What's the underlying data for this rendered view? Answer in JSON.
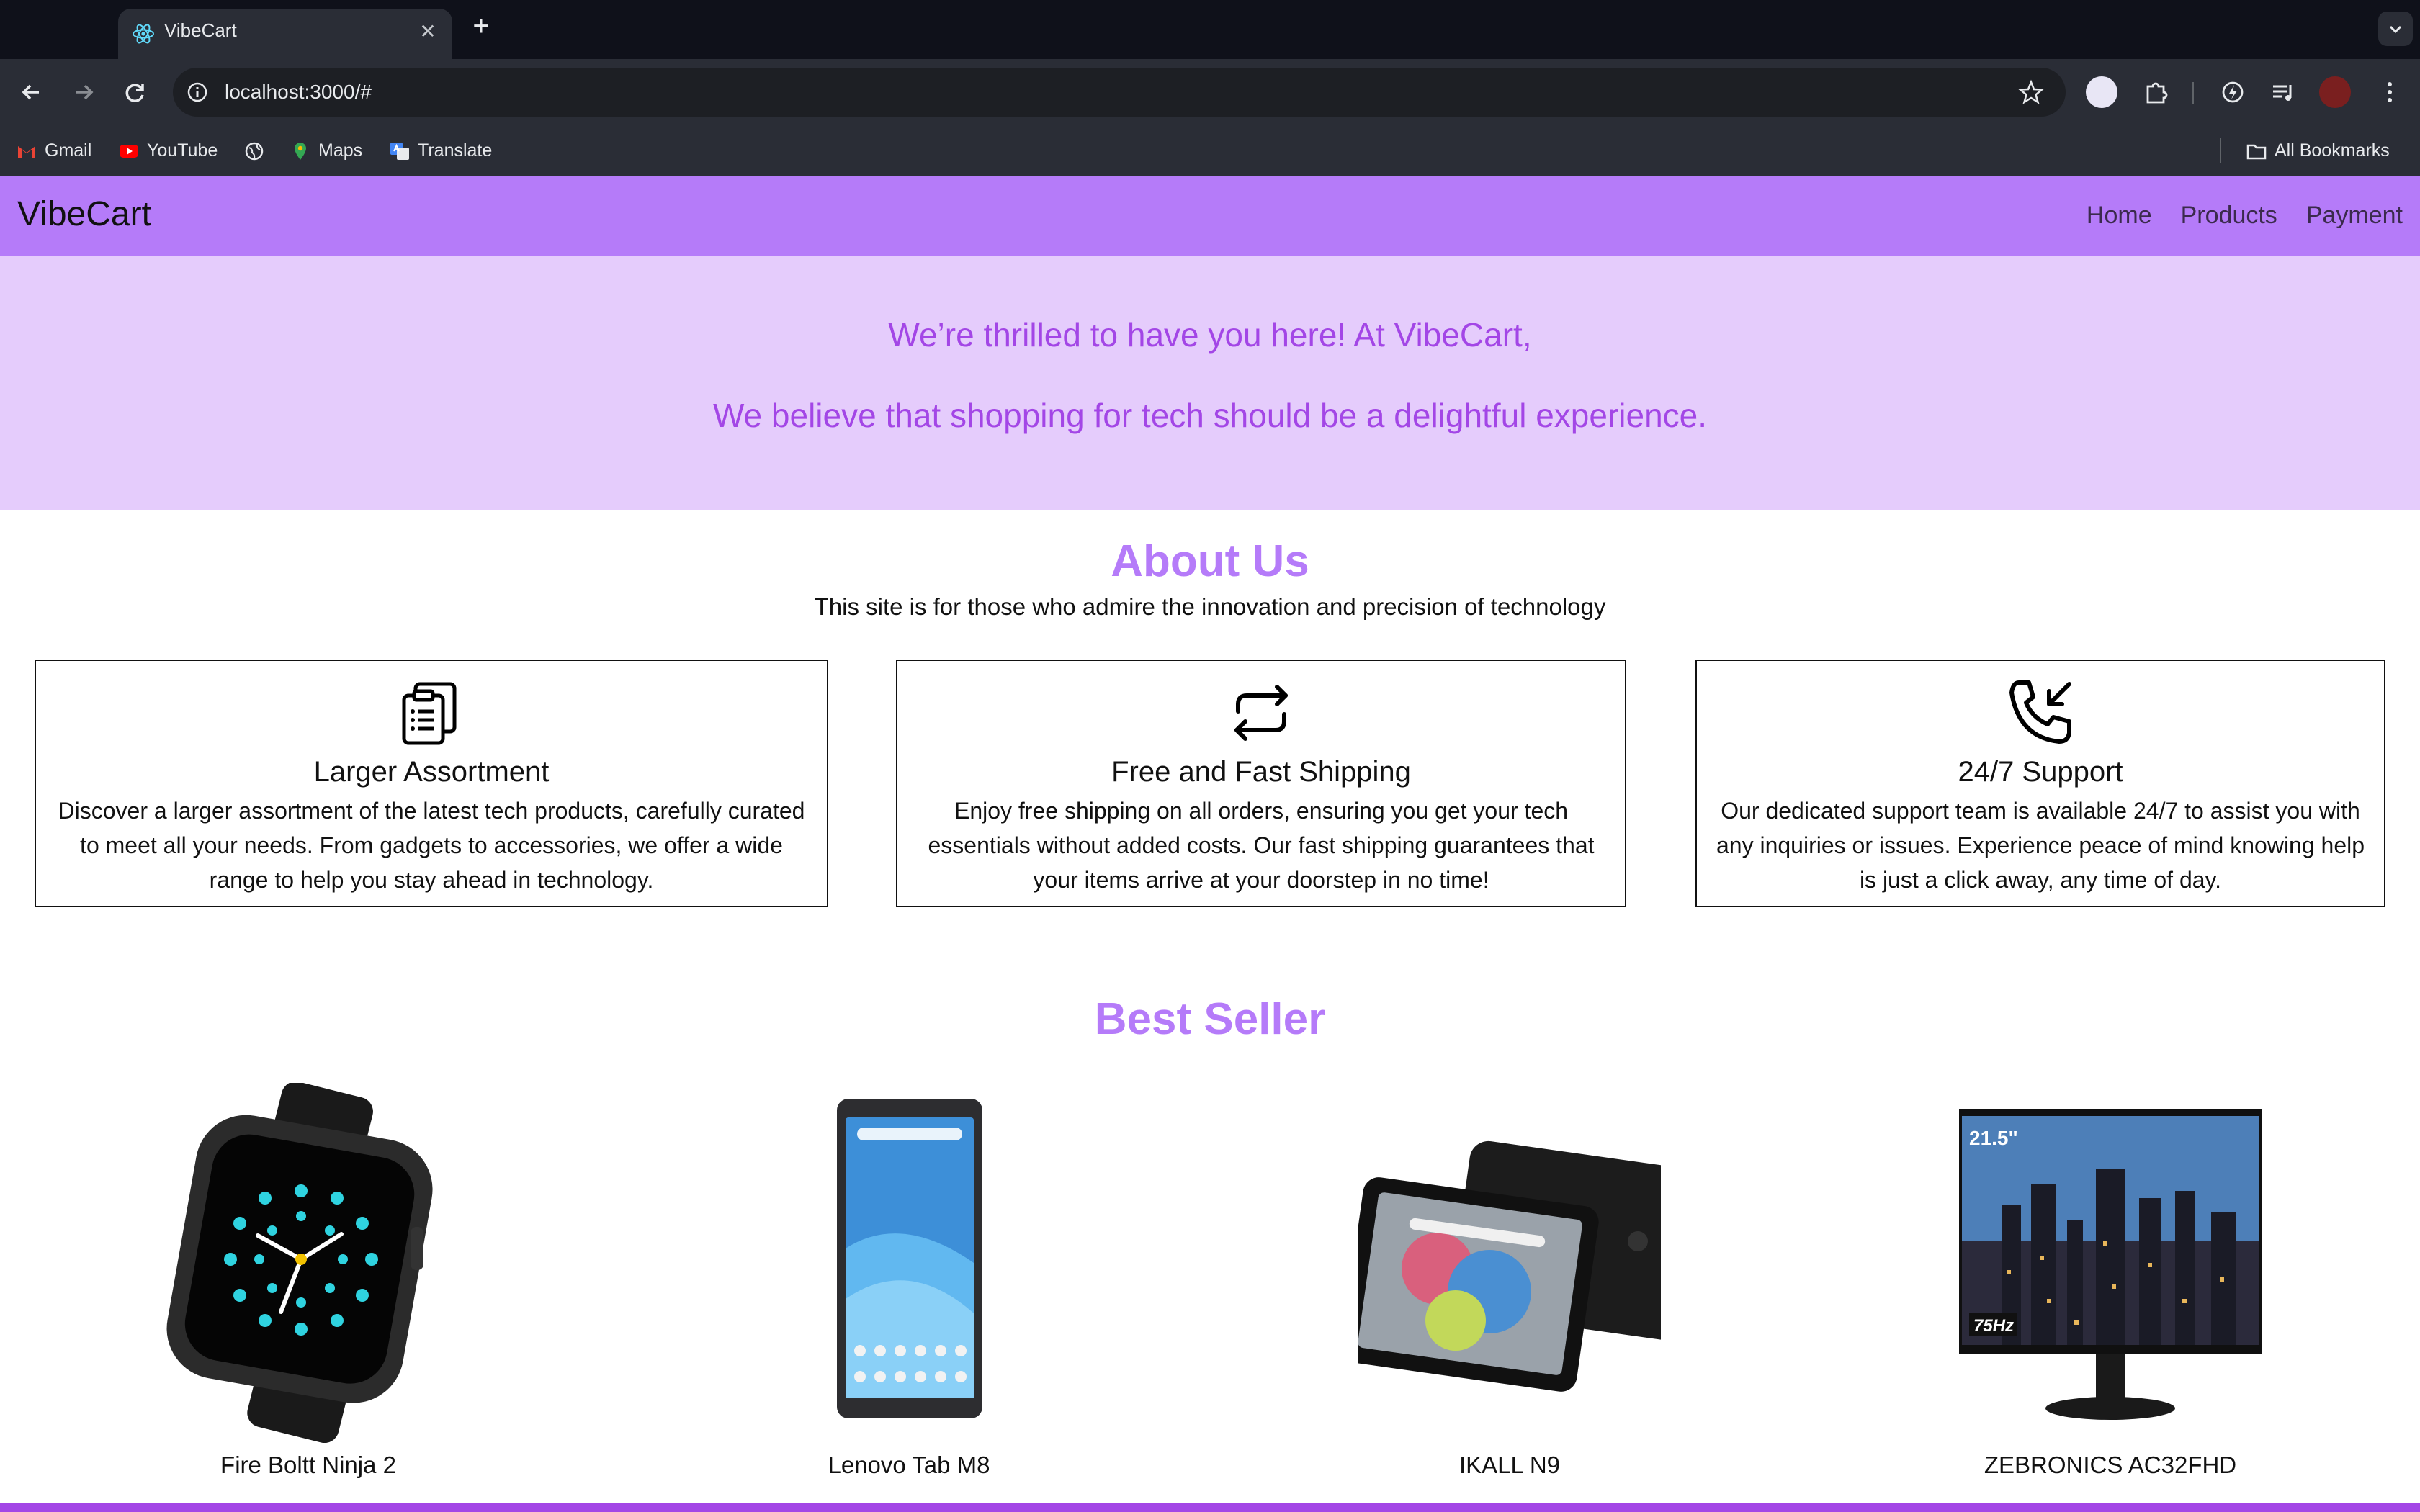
{
  "browser": {
    "tab_title": "VibeCart",
    "url": "localhost:3000/#",
    "bookmarks": {
      "gmail": "Gmail",
      "youtube": "YouTube",
      "maps": "Maps",
      "translate": "Translate",
      "all_bookmarks": "All Bookmarks"
    }
  },
  "nav": {
    "brand": "VibeCart",
    "links": [
      "Home",
      "Products",
      "Payment"
    ]
  },
  "hero": {
    "line1": "We’re thrilled to have you here! At VibeCart,",
    "line2": "We believe that shopping for tech should be a delightful experience."
  },
  "about": {
    "title": "About Us",
    "subtitle": "This site is for those who admire the innovation and precision of technology",
    "cards": [
      {
        "icon": "clipboard-list-icon",
        "title": "Larger Assortment",
        "text": "Discover a larger assortment of the latest tech products, carefully curated to meet all your needs. From gadgets to accessories, we offer a wide range to help you stay ahead in technology."
      },
      {
        "icon": "repeat-arrows-icon",
        "title": "Free and Fast Shipping",
        "text": "Enjoy free shipping on all orders, ensuring you get your tech essentials without added costs. Our fast shipping guarantees that your items arrive at your doorstep in no time!"
      },
      {
        "icon": "phone-incoming-icon",
        "title": "24/7 Support",
        "text": "Our dedicated support team is available 24/7 to assist you with any inquiries or issues. Experience peace of mind knowing help is just a click away, any time of day."
      }
    ]
  },
  "best_seller": {
    "title": "Best Seller",
    "products": [
      {
        "name": "Fire Boltt Ninja 2",
        "image": "smartwatch-image"
      },
      {
        "name": "Lenovo Tab M8",
        "image": "tablet-image"
      },
      {
        "name": "IKALL N9",
        "image": "tablet-with-case-image"
      },
      {
        "name": "ZEBRONICS AC32FHD",
        "image": "monitor-image",
        "screen_badge": "21.5\"",
        "refresh_badge": "75Hz"
      }
    ]
  },
  "colors": {
    "nav_bg": "#b57bf9",
    "hero_bg": "#e5ccfc",
    "accent_text": "#a346e6",
    "heading": "#b57bf9"
  }
}
